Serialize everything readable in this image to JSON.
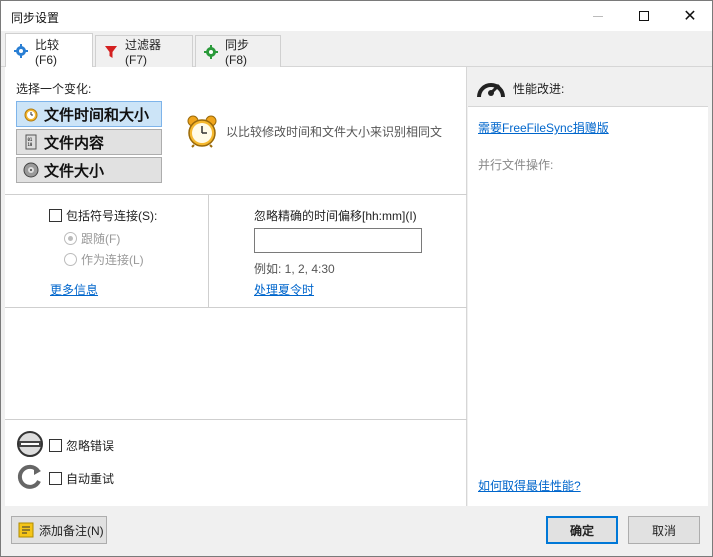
{
  "window": {
    "title": "同步设置"
  },
  "titlebar": {
    "minimize_icon": "minimize-icon",
    "maximize_icon": "maximize-icon",
    "close_icon": "close-icon"
  },
  "tabs": [
    {
      "label": "比较 (F6)",
      "icon": "gear-icon",
      "active": true
    },
    {
      "label": "过滤器 (F7)",
      "icon": "filter-icon",
      "active": false
    },
    {
      "label": "同步 (F8)",
      "icon": "gear-green-icon",
      "active": false
    }
  ],
  "compare": {
    "choose_label": "选择一个变化:",
    "variants": [
      {
        "label": "文件时间和大小",
        "icon": "clock-icon",
        "selected": true
      },
      {
        "label": "文件内容",
        "icon": "file-content-icon",
        "selected": false
      },
      {
        "label": "文件大小",
        "icon": "disk-icon",
        "selected": false
      }
    ],
    "description": "以比较修改时间和文件大小来识别相同文",
    "symlinks": {
      "checkbox_label": "包括符号连接(S):",
      "radio_follow": "跟随(F)",
      "radio_as_link": "作为连接(L)",
      "more_info": "更多信息"
    },
    "time_shift": {
      "label": "忽略精确的时间偏移[hh:mm](I)",
      "value": "",
      "example": "例如: 1, 2, 4:30",
      "dst_link": "处理夏令时"
    },
    "ignore_errors": "忽略错误",
    "auto_retry": "自动重试"
  },
  "performance": {
    "title": "性能改进:",
    "donation_link": "需要FreeFileSync捐赠版",
    "parallel_ops": "并行文件操作:",
    "best_perf_link": "如何取得最佳性能?"
  },
  "footer": {
    "add_note": "添加备注(N)",
    "ok": "确定",
    "cancel": "取消"
  },
  "colors": {
    "link": "#0066cc",
    "selected_bg": "#cce4f7",
    "accent": "#0078d7"
  }
}
